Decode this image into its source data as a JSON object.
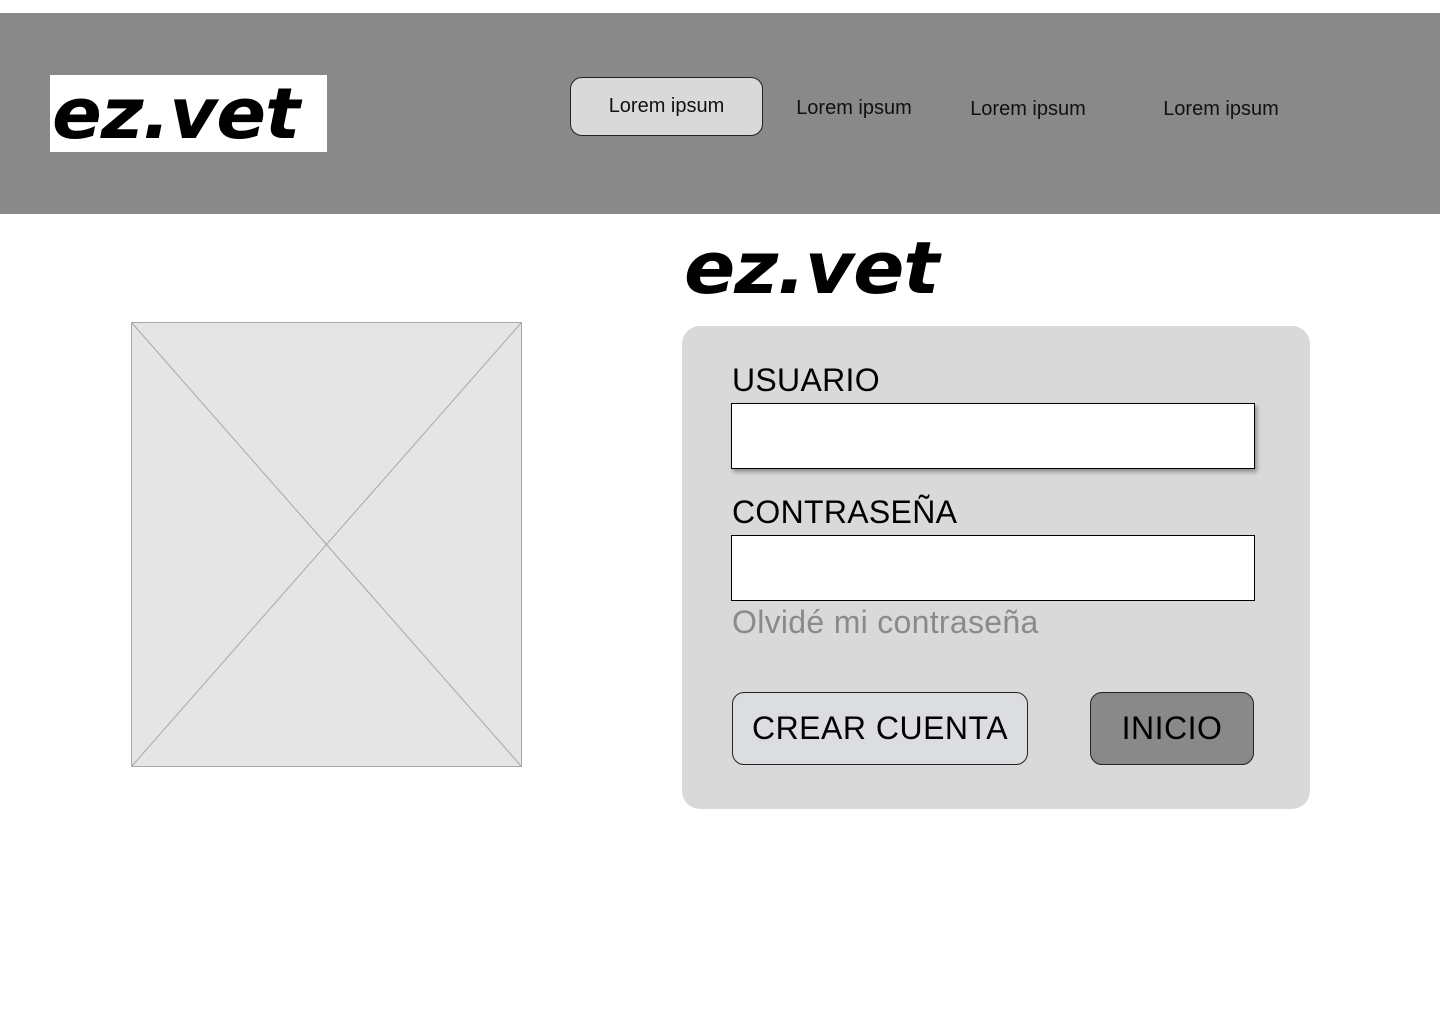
{
  "header": {
    "logo_text": "ez.vet",
    "nav": [
      {
        "label": "Lorem ipsum",
        "active": true
      },
      {
        "label": "Lorem ipsum",
        "active": false
      },
      {
        "label": "Lorem ipsum",
        "active": false
      },
      {
        "label": "Lorem ipsum",
        "active": false
      }
    ]
  },
  "main": {
    "logo_text": "ez.vet",
    "image_placeholder_icon": "image-placeholder-icon",
    "login": {
      "username_label": "USUARIO",
      "username_value": "",
      "password_label": "CONTRASEÑA",
      "password_value": "",
      "forgot_password": "Olvidé mi contraseña",
      "create_account_label": "CREAR CUENTA",
      "login_label": "INICIO"
    }
  },
  "colors": {
    "header_bg": "#898989",
    "card_bg": "#d9d9d9",
    "active_nav_bg": "#d9d9d9",
    "create_button_bg": "#dcdde1",
    "login_button_bg": "#898989",
    "forgot_link": "#8a8a8a",
    "placeholder_bg": "#e5e5e5"
  }
}
